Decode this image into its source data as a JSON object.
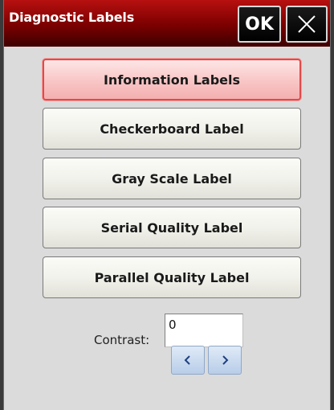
{
  "window": {
    "title": "Diagnostic Labels",
    "ok_label": "OK",
    "close_icon": "close-icon"
  },
  "buttons": [
    {
      "label": "Information Labels",
      "selected": true
    },
    {
      "label": "Checkerboard Label",
      "selected": false
    },
    {
      "label": "Gray Scale Label",
      "selected": false
    },
    {
      "label": "Serial Quality Label",
      "selected": false
    },
    {
      "label": "Parallel Quality Label",
      "selected": false
    }
  ],
  "contrast": {
    "label": "Contrast:",
    "value": "0",
    "decrease_icon": "chevron-left-icon",
    "increase_icon": "chevron-right-icon"
  },
  "colors": {
    "titlebar": "#9a0000",
    "selected_border": "#e04a4a",
    "background": "#dbdbdb"
  }
}
